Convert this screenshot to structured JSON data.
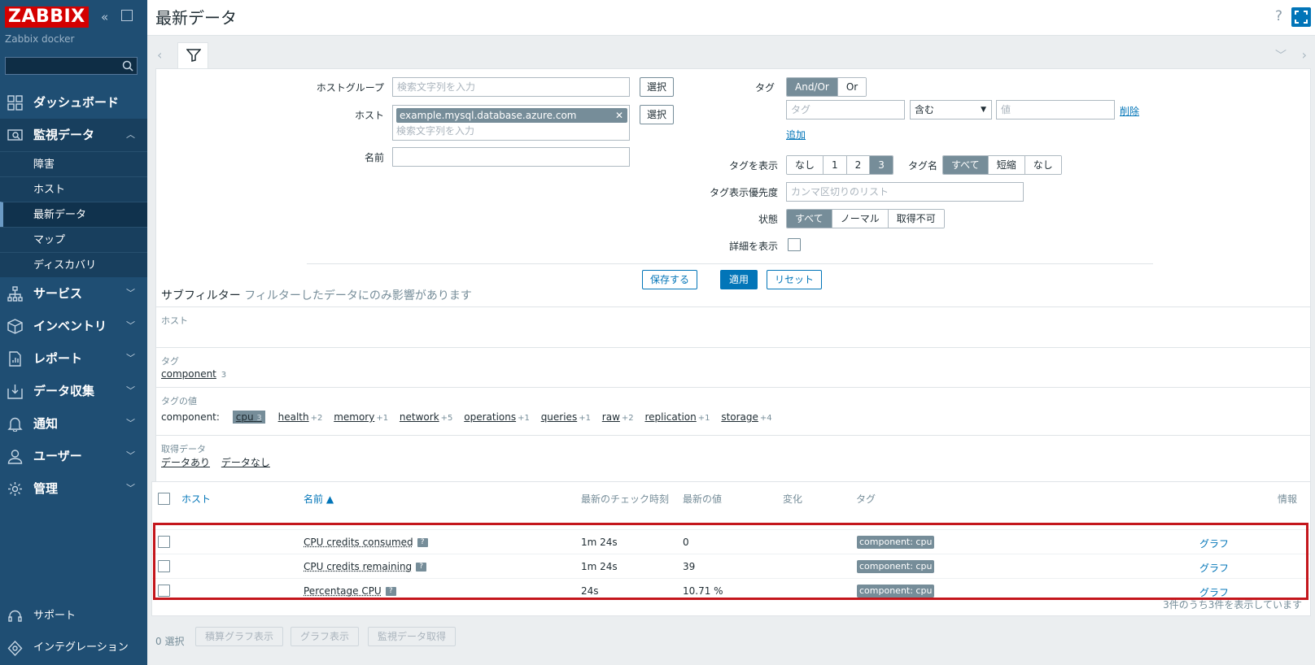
{
  "sidebar": {
    "logo": "ZABBIX",
    "server_name": "Zabbix docker",
    "search_value": "",
    "menu": [
      {
        "label": "ダッシュボード",
        "icon": "dashboard-icon"
      },
      {
        "label": "監視データ",
        "icon": "monitoring-icon",
        "open": true
      },
      {
        "label": "サービス",
        "icon": "services-icon"
      },
      {
        "label": "インベントリ",
        "icon": "inventory-icon"
      },
      {
        "label": "レポート",
        "icon": "reports-icon"
      },
      {
        "label": "データ収集",
        "icon": "data-collection-icon"
      },
      {
        "label": "通知",
        "icon": "alerts-icon"
      },
      {
        "label": "ユーザー",
        "icon": "users-icon"
      },
      {
        "label": "管理",
        "icon": "administration-icon"
      }
    ],
    "submenu": [
      "障害",
      "ホスト",
      "最新データ",
      "マップ",
      "ディスカバリ"
    ],
    "support": "サポート",
    "integrations": "インテグレーション"
  },
  "header": {
    "title": "最新データ",
    "help": "?"
  },
  "filter": {
    "host_group_label": "ホストグループ",
    "host_group_placeholder": "検索文字列を入力",
    "select_label": "選択",
    "host_label": "ホスト",
    "host_chip": "example.mysql.database.azure.com",
    "host_placeholder": "検索文字列を入力",
    "name_label": "名前",
    "name_value": "",
    "tag_label": "タグ",
    "tag_operator": [
      "And/Or",
      "Or"
    ],
    "tag_placeholder": "タグ",
    "tag_condition": "含む",
    "tag_value_placeholder": "値",
    "remove_label": "削除",
    "add_label": "追加",
    "show_tags_label": "タグを表示",
    "show_tags_options": [
      "なし",
      "1",
      "2",
      "3"
    ],
    "tag_name_label": "タグ名",
    "tag_name_options": [
      "すべて",
      "短縮",
      "なし"
    ],
    "tag_priority_label": "タグ表示優先度",
    "tag_priority_placeholder": "カンマ区切りのリスト",
    "state_label": "状態",
    "state_options": [
      "すべて",
      "ノーマル",
      "取得不可"
    ],
    "show_details_label": "詳細を表示",
    "save_as": "保存する",
    "apply": "適用",
    "reset": "リセット"
  },
  "subfilter": {
    "title": "サブフィルター",
    "subtitle": "フィルターしたデータにのみ影響があります",
    "hosts_title": "ホスト",
    "tags_title": "タグ",
    "tags": [
      {
        "name": "component",
        "count": "3"
      }
    ],
    "tag_values_title": "タグの値",
    "tag_values_prefix": "component:",
    "tag_values": [
      {
        "name": "cpu",
        "count": "3",
        "selected": true
      },
      {
        "name": "health",
        "count": "+2"
      },
      {
        "name": "memory",
        "count": "+1"
      },
      {
        "name": "network",
        "count": "+5"
      },
      {
        "name": "operations",
        "count": "+1"
      },
      {
        "name": "queries",
        "count": "+1"
      },
      {
        "name": "raw",
        "count": "+2"
      },
      {
        "name": "replication",
        "count": "+1"
      },
      {
        "name": "storage",
        "count": "+4"
      }
    ],
    "data_title": "取得データ",
    "data_options": [
      "データあり",
      "データなし"
    ]
  },
  "table": {
    "columns": {
      "host": "ホスト",
      "name": "名前 ▲",
      "last_check": "最新のチェック時刻",
      "last_value": "最新の値",
      "change": "変化",
      "tags": "タグ",
      "info": "情報"
    },
    "rows": [
      {
        "name": "CPU credits consumed",
        "last_check": "1m 24s",
        "last_value": "0",
        "tag": "component: cpu",
        "graph": "グラフ"
      },
      {
        "name": "CPU credits remaining",
        "last_check": "1m 24s",
        "last_value": "39",
        "tag": "component: cpu",
        "graph": "グラフ"
      },
      {
        "name": "Percentage CPU",
        "last_check": "24s",
        "last_value": "10.71 %",
        "tag": "component: cpu",
        "graph": "グラフ"
      }
    ],
    "footer": "3件のうち3件を表示しています"
  },
  "actions": {
    "selected": "0 選択",
    "stacked_graph": "積算グラフ表示",
    "graph": "グラフ表示",
    "execute_now": "監視データ取得"
  }
}
